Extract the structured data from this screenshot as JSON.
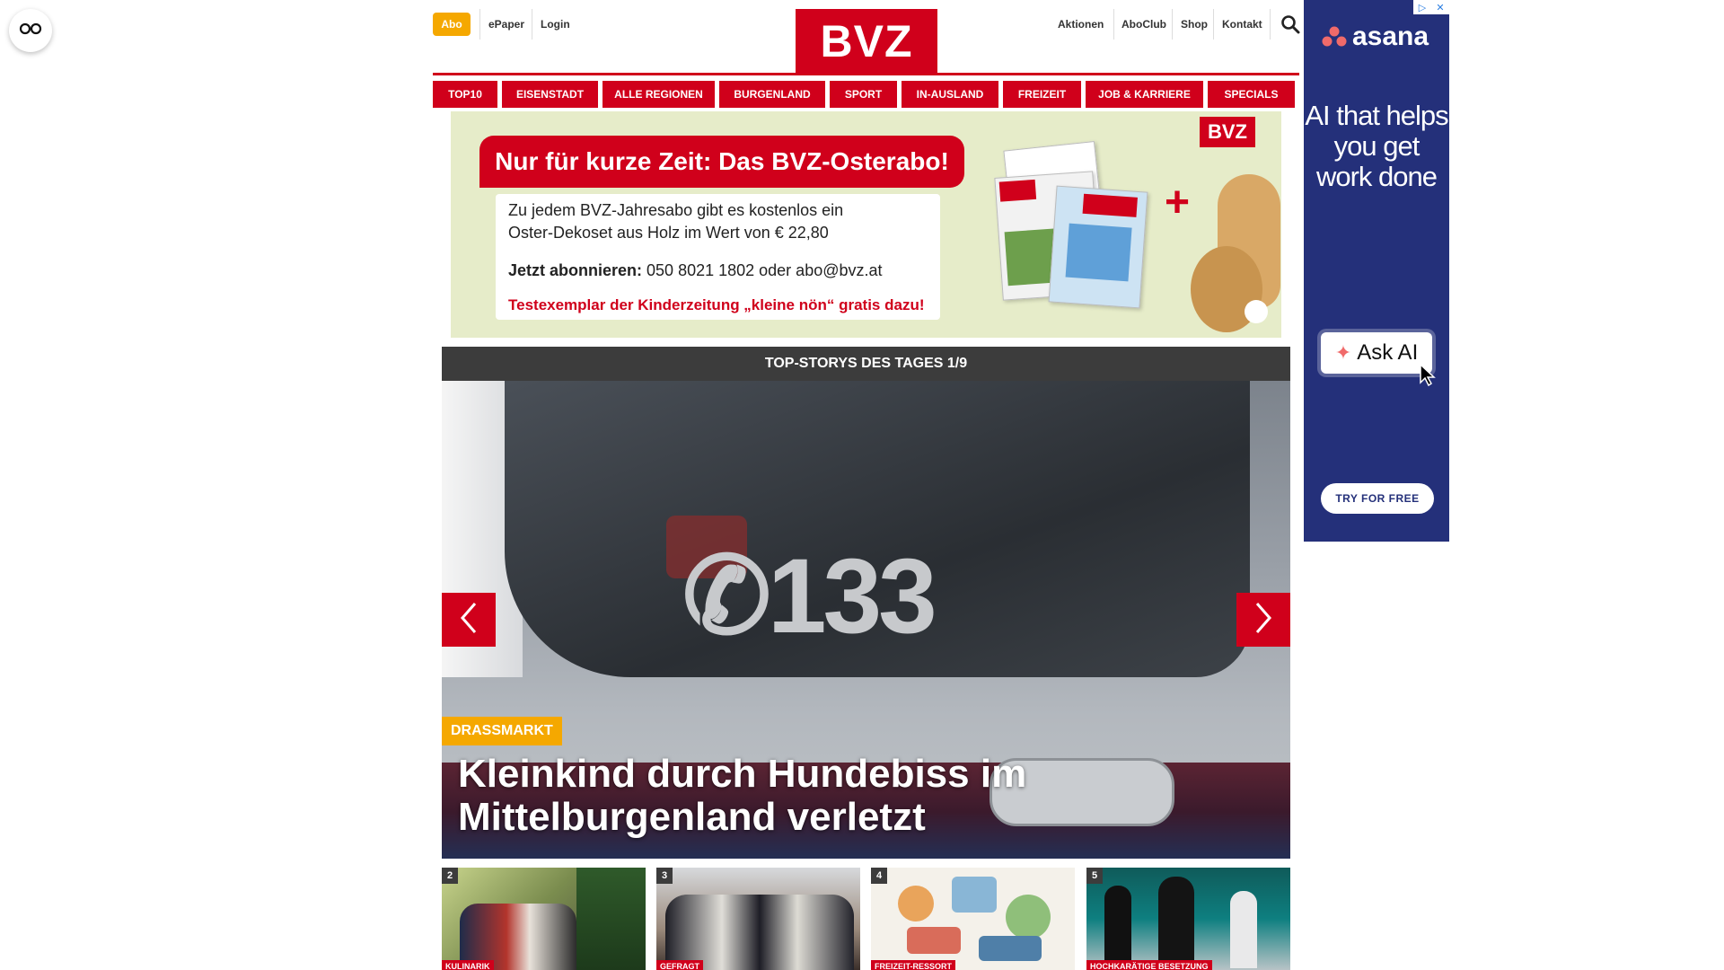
{
  "header": {
    "abo": "Abo",
    "epaper": "ePaper",
    "login": "Login",
    "logo": "BVZ",
    "aktionen": "Aktionen",
    "aboclub": "AboClub",
    "shop": "Shop",
    "kontakt": "Kontakt"
  },
  "nav": [
    "TOP10",
    "EISENSTADT",
    "ALLE REGIONEN",
    "BURGENLAND",
    "SPORT",
    "IN-AUSLAND",
    "FREIZEIT",
    "JOB & KARRIERE",
    "SPECIALS"
  ],
  "promo": {
    "title": "Nur für kurze Zeit: Das BVZ-Osterabo!",
    "line1": "Zu jedem BVZ-Jahresabo gibt es kostenlos ein",
    "line2": "Oster-Dekoset aus Holz im Wert von € 22,80",
    "subscribe_label": "Jetzt abonnieren:",
    "subscribe_contact": " 050 8021 1802 oder abo@bvz.at",
    "red_line": "Testexemplar der Kinderzeitung „kleine nön“ gratis dazu!",
    "badge": "BVZ"
  },
  "hero": {
    "header": "TOP-STORYS DES TAGES 1/9",
    "image_number": "133",
    "tag": "DRASSMARKT",
    "headline_line1": "Kleinkind durch Hundebiss im",
    "headline_line2": "Mittelburgenland verletzt"
  },
  "ad": {
    "brand": "asana",
    "headline": "AI that helps you get work done",
    "ask": "Ask AI",
    "cta": "TRY FOR FREE"
  },
  "cards": [
    {
      "num": "2",
      "tag": "KULINARIK"
    },
    {
      "num": "3",
      "tag": "GEFRAGT"
    },
    {
      "num": "4",
      "tag": "FREIZEIT-RESSORT"
    },
    {
      "num": "5",
      "tag": "HOCHKARÄTIGE BESETZUNG"
    }
  ],
  "colors": {
    "brand_red": "#d0001b",
    "accent_yellow": "#f5a800",
    "ad_blue": "#24307a"
  }
}
